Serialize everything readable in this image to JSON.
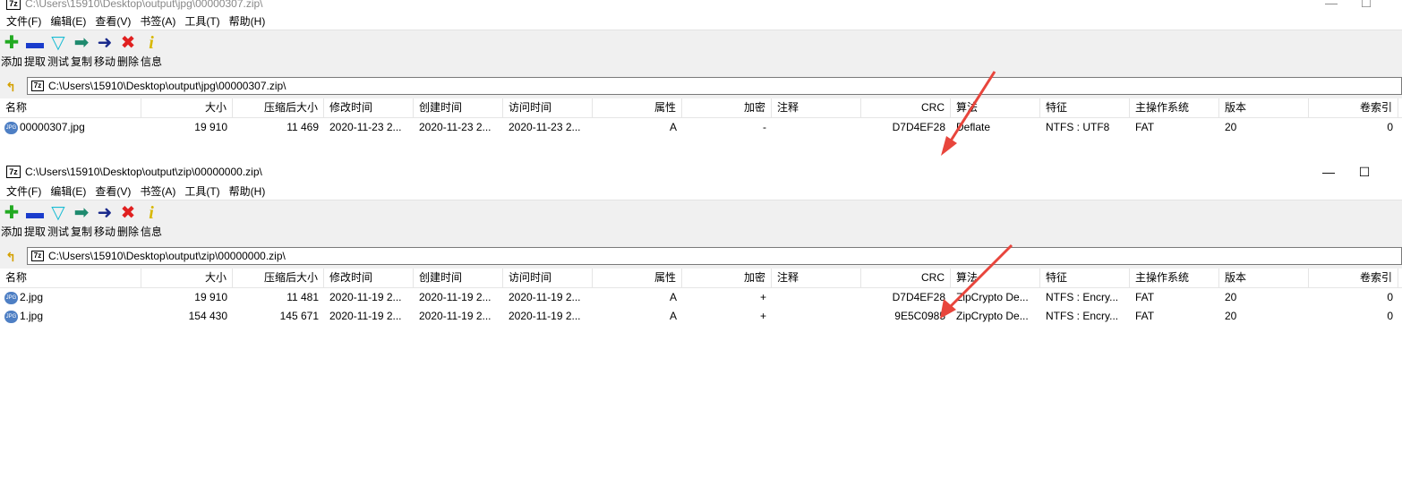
{
  "menu": [
    "文件(F)",
    "编辑(E)",
    "查看(V)",
    "书签(A)",
    "工具(T)",
    "帮助(H)"
  ],
  "toolbar": [
    {
      "icon": "add-icon",
      "label": "添加",
      "color": "#22aa22"
    },
    {
      "icon": "extract-icon",
      "label": "提取",
      "color": "#1a3ccc"
    },
    {
      "icon": "test-icon",
      "label": "测试",
      "color": "#19bcd4"
    },
    {
      "icon": "copy-icon",
      "label": "复制",
      "color": "#1e8a6e"
    },
    {
      "icon": "move-icon",
      "label": "移动",
      "color": "#1a2a8c"
    },
    {
      "icon": "delete-icon",
      "label": "删除",
      "color": "#e02020"
    },
    {
      "icon": "info-icon",
      "label": "信息",
      "color": "#d8b800"
    }
  ],
  "columns": [
    "名称",
    "大小",
    "压缩后大小",
    "修改时间",
    "创建时间",
    "访问时间",
    "属性",
    "加密",
    "注释",
    "CRC",
    "算法",
    "特征",
    "主操作系统",
    "版本",
    "卷索引"
  ],
  "windows": [
    {
      "title": "C:\\Users\\15910\\Desktop\\output\\jpg\\00000307.zip\\",
      "address": "C:\\Users\\15910\\Desktop\\output\\jpg\\00000307.zip\\",
      "rows": [
        {
          "name": "00000307.jpg",
          "size": "19 910",
          "packed": "11 469",
          "modified": "2020-11-23 2...",
          "created": "2020-11-23 2...",
          "accessed": "2020-11-23 2...",
          "attr": "A",
          "encrypted": "-",
          "comment": "",
          "crc": "D7D4EF28",
          "method": "Deflate",
          "characteristics": "NTFS : UTF8",
          "host_os": "FAT",
          "version": "20",
          "volume": "0"
        }
      ]
    },
    {
      "title": "C:\\Users\\15910\\Desktop\\output\\zip\\00000000.zip\\",
      "address": "C:\\Users\\15910\\Desktop\\output\\zip\\00000000.zip\\",
      "rows": [
        {
          "name": "2.jpg",
          "size": "19 910",
          "packed": "11 481",
          "modified": "2020-11-19 2...",
          "created": "2020-11-19 2...",
          "accessed": "2020-11-19 2...",
          "attr": "A",
          "encrypted": "+",
          "comment": "",
          "crc": "D7D4EF28",
          "method": "ZipCrypto De...",
          "characteristics": "NTFS : Encry...",
          "host_os": "FAT",
          "version": "20",
          "volume": "0"
        },
        {
          "name": "1.jpg",
          "size": "154 430",
          "packed": "145 671",
          "modified": "2020-11-19 2...",
          "created": "2020-11-19 2...",
          "accessed": "2020-11-19 2...",
          "attr": "A",
          "encrypted": "+",
          "comment": "",
          "crc": "9E5C0985",
          "method": "ZipCrypto De...",
          "characteristics": "NTFS : Encry...",
          "host_os": "FAT",
          "version": "20",
          "volume": "0"
        }
      ]
    }
  ],
  "window_controls": {
    "minimize": "—",
    "maximize": "☐"
  },
  "icons": {
    "app": "7z",
    "file": "JPG",
    "up": "↰"
  },
  "annotation_color": "#e8453c"
}
